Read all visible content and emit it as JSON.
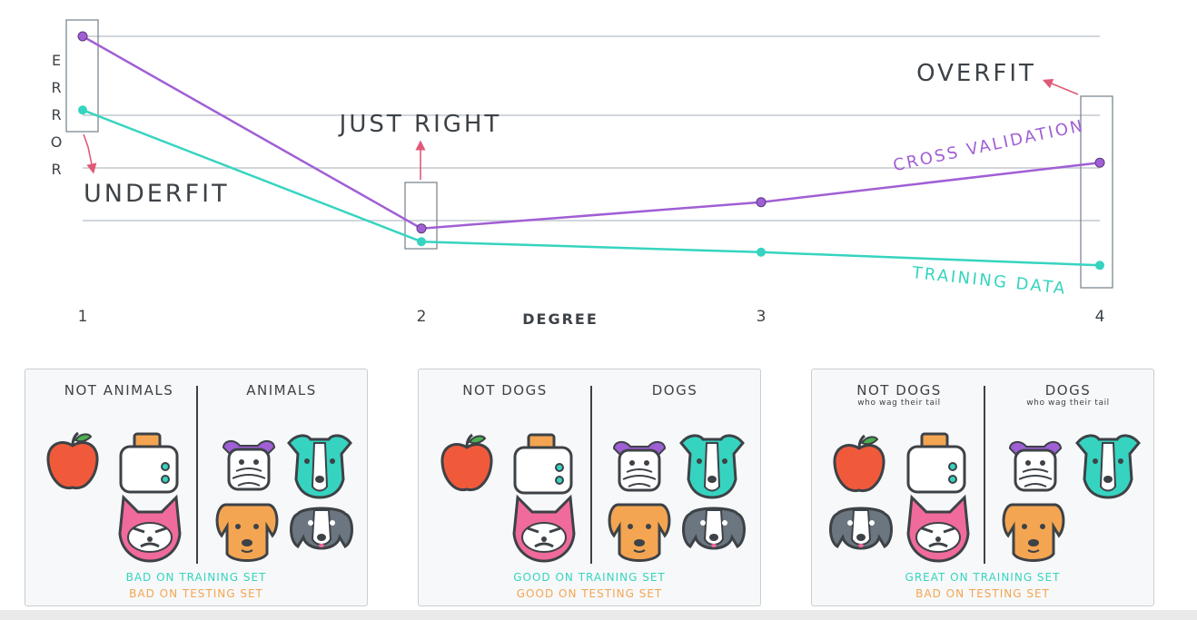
{
  "chart_data": {
    "type": "line",
    "x": [
      1,
      2,
      3,
      4
    ],
    "xlabel": "DEGREE",
    "ylabel": "ERROR",
    "tick_labels": [
      "1",
      "2",
      "3",
      "4"
    ],
    "series": [
      {
        "name": "CROSS VALIDATION",
        "values": [
          10.0,
          2.7,
          3.7,
          5.2
        ],
        "color": "#a05fd5"
      },
      {
        "name": "TRAINING DATA",
        "values": [
          7.2,
          2.2,
          1.8,
          1.3
        ],
        "color": "#36d4c0"
      }
    ],
    "ylim": [
      0,
      10.5
    ],
    "gridlines": [
      3,
      5,
      7,
      10
    ],
    "annotations": [
      {
        "text": "UNDERFIT",
        "x": 1
      },
      {
        "text": "JUST RIGHT",
        "x": 2
      },
      {
        "text": "OVERFIT",
        "x": 4
      }
    ]
  },
  "panels": [
    {
      "left_title": "NOT ANIMALS",
      "left_sub": "",
      "right_title": "ANIMALS",
      "right_sub": "",
      "train": "BAD ON TRAINING SET",
      "test": "BAD ON TESTING SET"
    },
    {
      "left_title": "NOT DOGS",
      "left_sub": "",
      "right_title": "DOGS",
      "right_sub": "",
      "train": "GOOD ON TRAINING SET",
      "test": "GOOD ON TESTING SET"
    },
    {
      "left_title": "NOT DOGS",
      "left_sub": "who wag their tail",
      "right_title": "DOGS",
      "right_sub": "who wag their tail",
      "train": "GREAT ON TRAINING SET",
      "test": "BAD ON TESTING SET"
    }
  ],
  "colors": {
    "cv": "#a05fd5",
    "train": "#36d4c0",
    "test_text": "#f4a552",
    "annotation_arrow": "#e05a78",
    "grid": "#c2c8cf",
    "text": "#3d4247"
  },
  "icons": [
    "apple-icon",
    "toaster-icon",
    "grumpy-cat-icon",
    "terrier-dog-icon",
    "teal-dog-icon",
    "orange-dog-icon",
    "grey-dog-icon"
  ]
}
